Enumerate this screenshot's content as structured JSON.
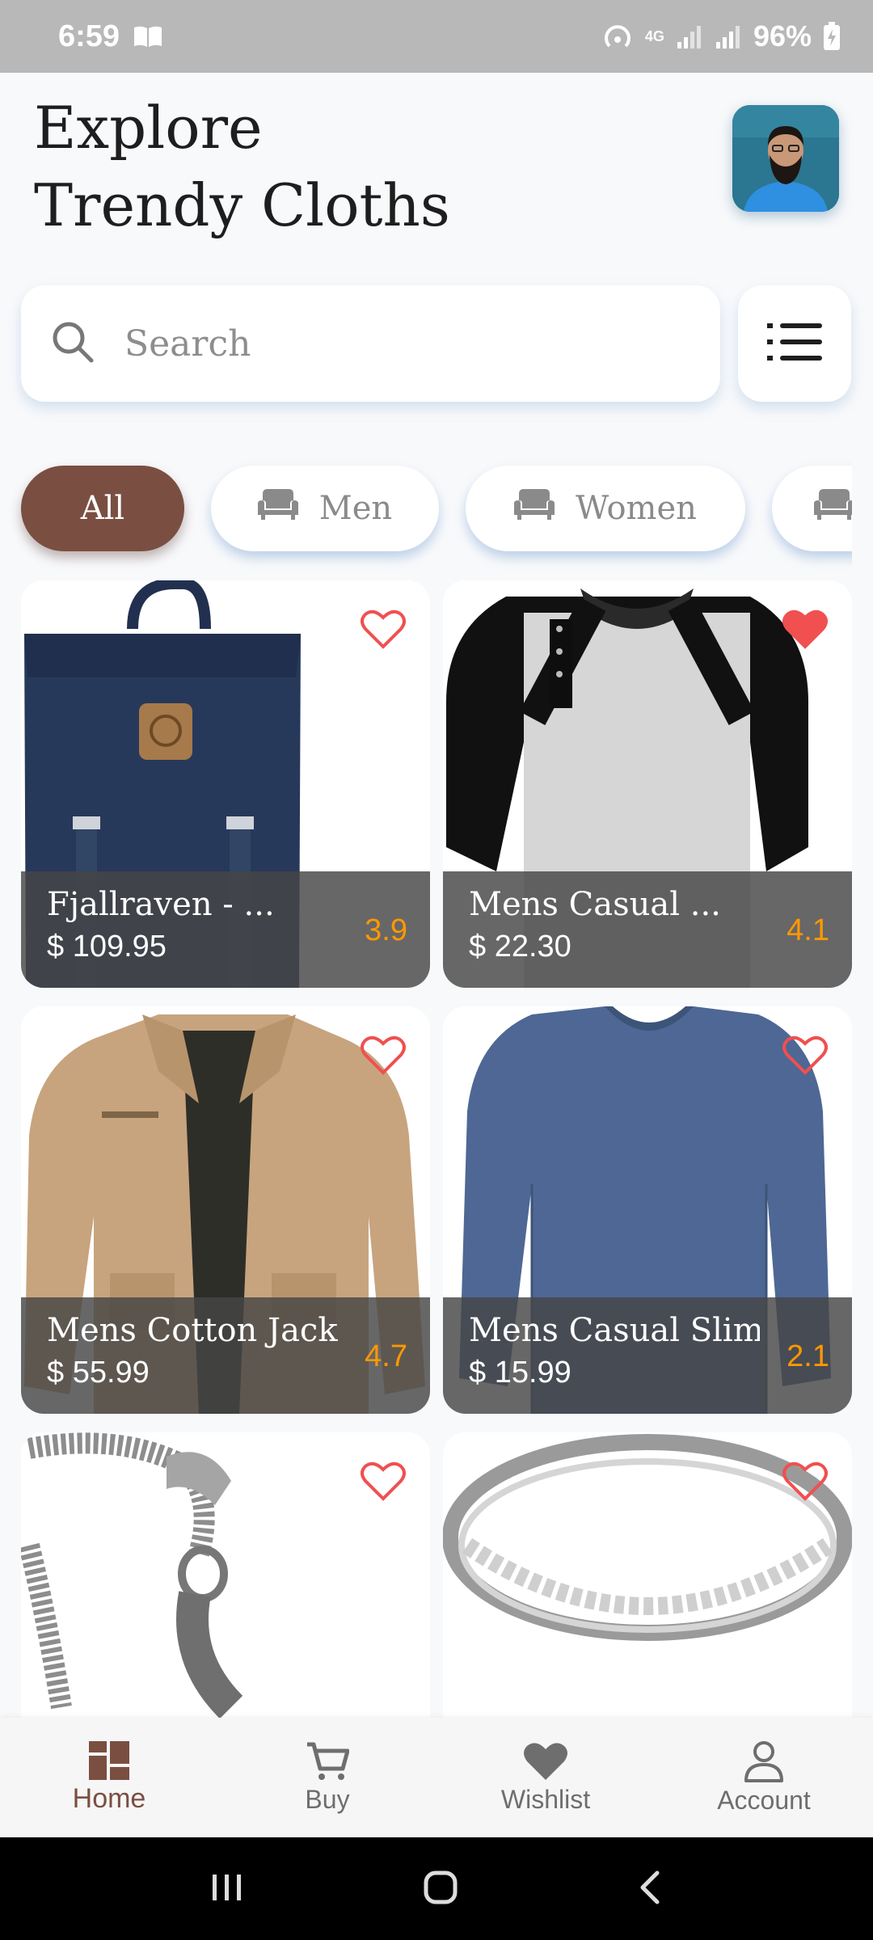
{
  "status_bar": {
    "time": "6:59",
    "network": "4G",
    "battery": "96%"
  },
  "header": {
    "title_line1": "Explore",
    "title_line2": "Trendy Cloths"
  },
  "search": {
    "placeholder": "Search"
  },
  "categories": [
    {
      "label": "All",
      "active": true
    },
    {
      "label": "Men",
      "active": false
    },
    {
      "label": "Women",
      "active": false
    },
    {
      "label": "",
      "active": false
    }
  ],
  "products": [
    {
      "name": "Fjallraven - ...",
      "price": "$ 109.95",
      "rating": "3.9",
      "favorite": false,
      "image": "backpack"
    },
    {
      "name": "Mens Casual ...",
      "price": "$ 22.30",
      "rating": "4.1",
      "favorite": true,
      "image": "raglan-tshirt"
    },
    {
      "name": "Mens Cotton Jacket",
      "price": "$ 55.99",
      "rating": "4.7",
      "favorite": false,
      "image": "jacket"
    },
    {
      "name": "Mens Casual Slim...",
      "price": "$ 15.99",
      "rating": "2.1",
      "favorite": false,
      "image": "long-sleeve-tee"
    },
    {
      "name": "",
      "price": "",
      "rating": "",
      "favorite": false,
      "image": "chain-bracelet"
    },
    {
      "name": "",
      "price": "",
      "rating": "",
      "favorite": false,
      "image": "silver-ring"
    }
  ],
  "bottom_nav": [
    {
      "label": "Home",
      "active": true,
      "icon": "grid-icon"
    },
    {
      "label": "Buy",
      "active": false,
      "icon": "cart-icon"
    },
    {
      "label": "Wishlist",
      "active": false,
      "icon": "heart-icon"
    },
    {
      "label": "Account",
      "active": false,
      "icon": "person-icon"
    }
  ],
  "colors": {
    "accent": "#7a4f42",
    "rating": "#ff9800",
    "heart": "#f05050",
    "background": "#f8f9fb"
  }
}
